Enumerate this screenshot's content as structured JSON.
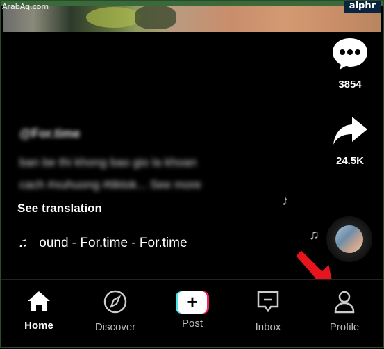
{
  "watermark": "ArabAq.com",
  "badge": "alphr",
  "side_actions": {
    "comment_count": "3854",
    "share_count": "24.5K"
  },
  "caption": {
    "author": "@For.time",
    "line1": "ban be thi khong bao gio la khoan",
    "line2": "cach #xuhuong #tiktok... See more",
    "see_translation": "See translation"
  },
  "music": {
    "note_glyph": "♫",
    "track": "ound - For.time - For.time"
  },
  "nav": {
    "home": "Home",
    "discover": "Discover",
    "post": "Post",
    "inbox": "Inbox",
    "profile": "Profile"
  },
  "colors": {
    "accent_cyan": "#4be3e8",
    "accent_pink": "#f0255a",
    "arrow_red": "#e6141c"
  }
}
